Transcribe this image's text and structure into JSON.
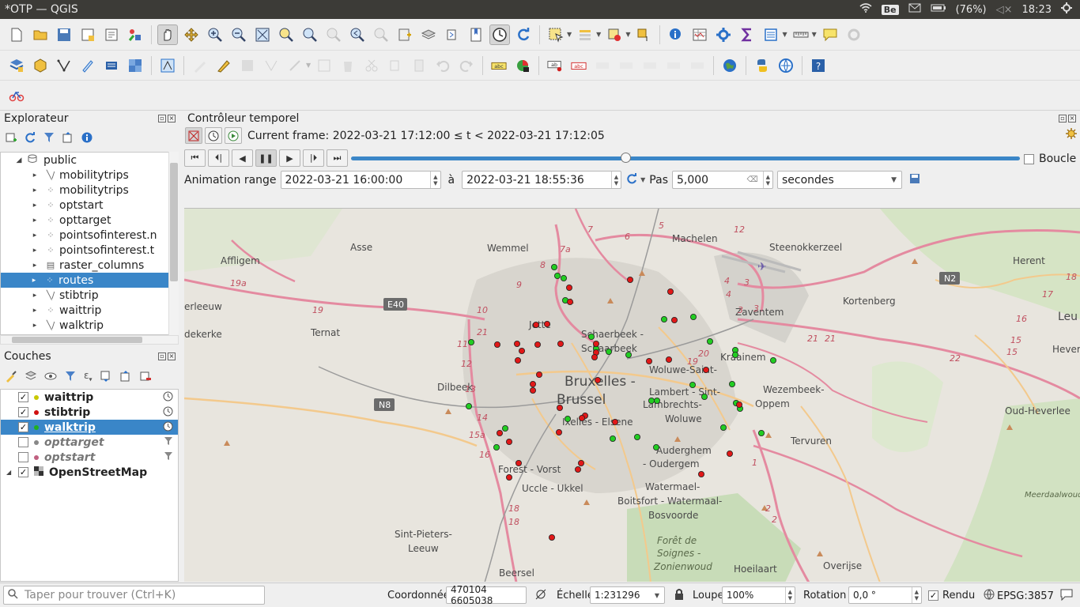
{
  "window": {
    "title": "*OTP — QGIS"
  },
  "system": {
    "keyboard": "Be",
    "battery": "(76%)",
    "time": "18:23"
  },
  "explorer": {
    "title": "Explorateur",
    "root": "public",
    "items": [
      {
        "label": "mobilitytrips",
        "type": "line"
      },
      {
        "label": "mobilitytrips",
        "type": "point"
      },
      {
        "label": "optstart",
        "type": "point"
      },
      {
        "label": "opttarget",
        "type": "point"
      },
      {
        "label": "pointsofinterest.n",
        "type": "point"
      },
      {
        "label": "pointsofinterest.t",
        "type": "point"
      },
      {
        "label": "raster_columns",
        "type": "table"
      },
      {
        "label": "routes",
        "type": "point"
      },
      {
        "label": "stibtrip",
        "type": "line"
      },
      {
        "label": "waittrip",
        "type": "point"
      },
      {
        "label": "walktrip",
        "type": "line"
      }
    ]
  },
  "layers": {
    "title": "Couches",
    "items": [
      {
        "label": "waittrip",
        "checked": true,
        "color": "#c8c800",
        "temporal": true
      },
      {
        "label": "stibtrip",
        "checked": true,
        "color": "#d01010",
        "temporal": true
      },
      {
        "label": "walktrip",
        "checked": true,
        "color": "#20b020",
        "temporal": true
      },
      {
        "label": "opttarget",
        "checked": false,
        "color": "#888888",
        "temporal": false
      },
      {
        "label": "optstart",
        "checked": false,
        "color": "#c06080",
        "temporal": false
      },
      {
        "label": "OpenStreetMap",
        "checked": true,
        "color": "",
        "temporal": false
      }
    ]
  },
  "temporal": {
    "title": "Contrôleur temporel",
    "current_frame": "Current frame: 2022-03-21 17:12:00 ≤ t < 2022-03-21 17:12:05",
    "loop_label": "Boucle",
    "range_label": "Animation range",
    "range_from": "2022-03-21 16:00:00",
    "range_to_label": "à",
    "range_to": "2022-03-21 18:55:36",
    "step_label": "Pas",
    "step_value": "5,000",
    "step_unit": "secondes",
    "slider_position": 0.41
  },
  "map": {
    "labels": [
      "Affligem",
      "Asse",
      "Wemmel",
      "Machelen",
      "Steenokkerzeel",
      "Herent",
      "Ternat",
      "Kortenberg",
      "Zaventem",
      "Leu",
      "Jette",
      "Schaerbeek - Schaarbeek",
      "Dilbeek",
      "Bruxelles - Brussel",
      "Woluwe-Saint-Lambert - Sint-Lambrechts-Woluwe",
      "Kraainem",
      "Wezembeek-Oppem",
      "Oud-Heverlee",
      "Hever",
      "Ixelles - Elsene",
      "Tervuren",
      "Auderghem - Oudergem",
      "Forest - Vorst",
      "Uccle - Ukkel",
      "Watermael-Boitsfort - Watermaal-Bosvoorde",
      "Sint-Pieters-Leeuw",
      "Forêt de Soignes - Zonienwoud",
      "Hoeilaart",
      "Overijse",
      "Beersel",
      "Meerdaalwoud",
      "erleeuw",
      "dekerke"
    ],
    "roads": [
      "E40",
      "N8",
      "N2"
    ]
  },
  "status": {
    "search_placeholder": "Taper pour trouver (Ctrl+K)",
    "coord_label": "Coordonnée",
    "coord_value": "470104 6605038",
    "scale_label": "Échelle",
    "scale_value": "1:231296",
    "magnifier_label": "Loupe",
    "magnifier_value": "100%",
    "rotation_label": "Rotation",
    "rotation_value": "0,0 °",
    "render_label": "Rendu",
    "crs": "EPSG:3857"
  }
}
